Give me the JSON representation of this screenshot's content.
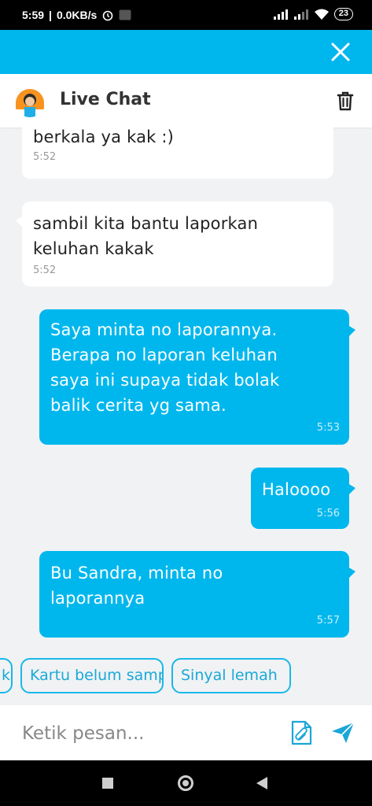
{
  "status_bar": {
    "time": "5:59",
    "speed": "0.0KB/s",
    "battery": "23"
  },
  "header": {
    "title": "Live Chat"
  },
  "messages": [
    {
      "direction": "in",
      "text": "berkala ya kak :)",
      "time": "5:52"
    },
    {
      "direction": "in",
      "text": "sambil kita bantu laporkan\nkeluhan kakak",
      "time": "5:52"
    },
    {
      "direction": "out",
      "text": "Saya minta no laporannya.\nBerapa no laporan keluhan\nsaya ini supaya tidak bolak\nbalik cerita yg sama.",
      "time": "5:53"
    },
    {
      "direction": "out",
      "text": "Haloooo",
      "time": "5:56"
    },
    {
      "direction": "out",
      "text": "Bu Sandra, minta no\nlaporannya",
      "time": "5:57"
    }
  ],
  "quick_replies": [
    "kartu",
    "Kartu belum sampai",
    "Sinyal lemah"
  ],
  "composer": {
    "placeholder": "Ketik pesan..."
  },
  "colors": {
    "accent": "#00b7ed",
    "background": "#f1f2f4"
  }
}
